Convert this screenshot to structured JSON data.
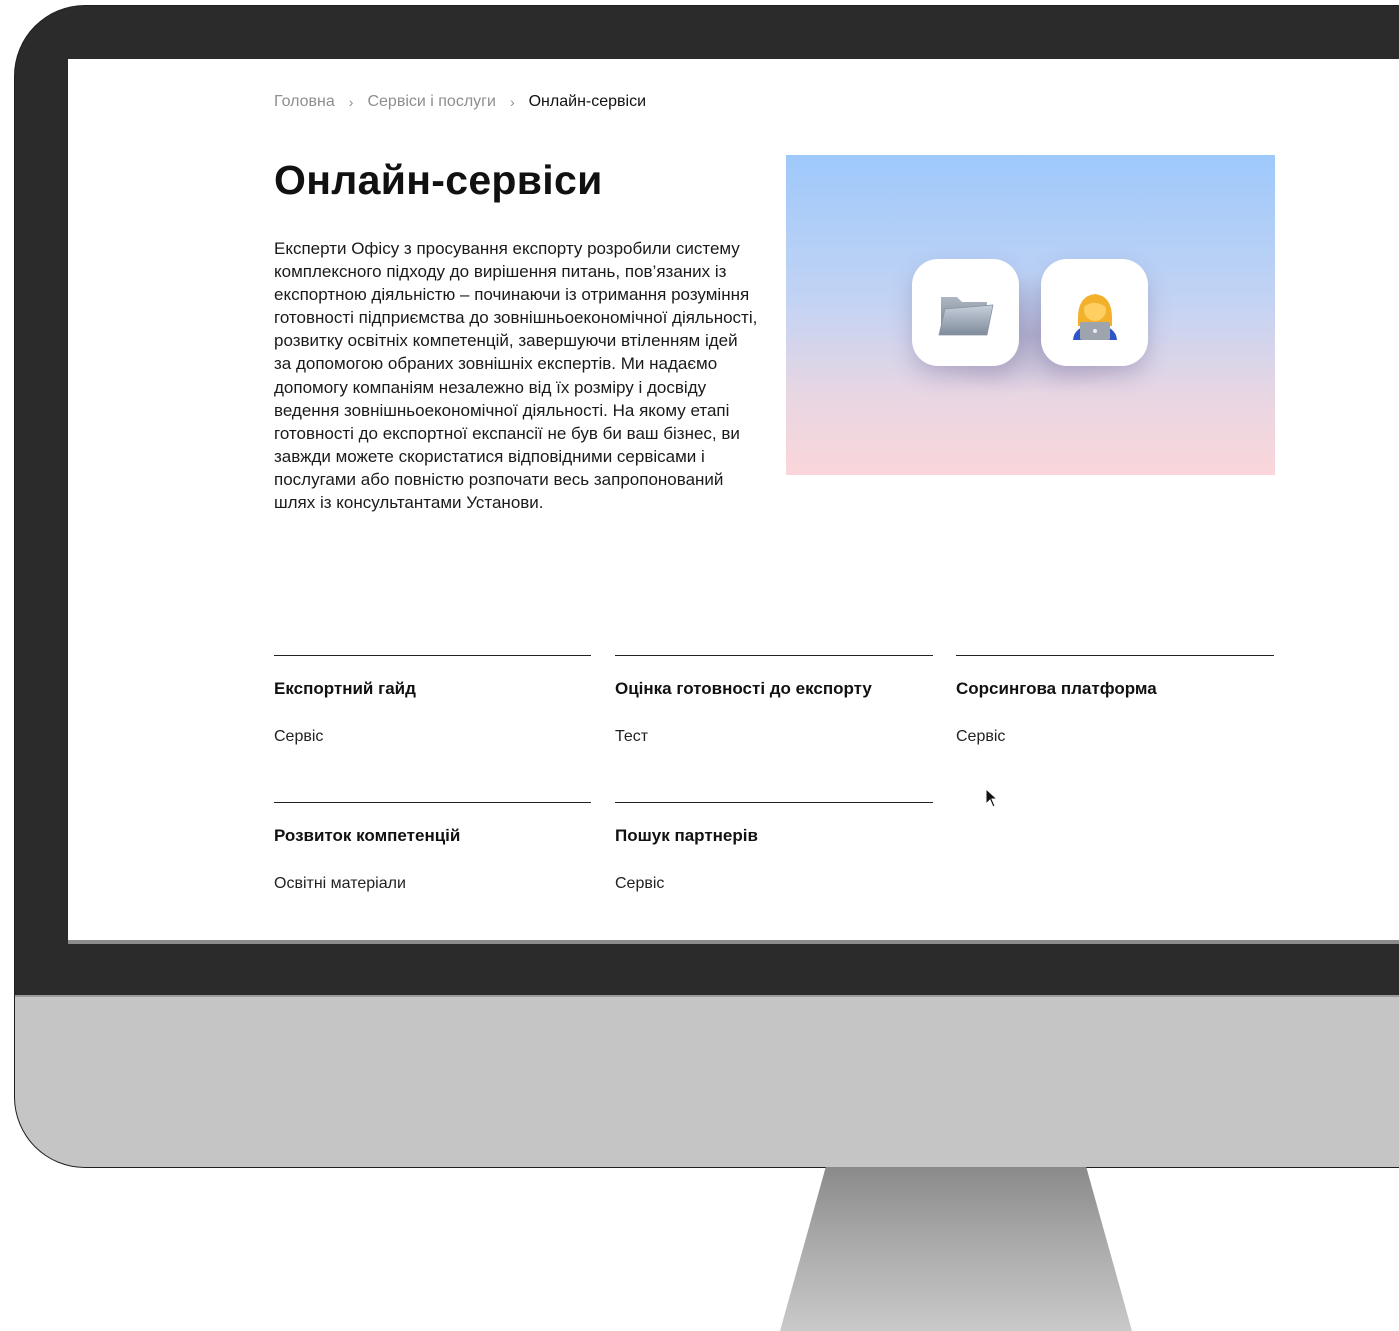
{
  "breadcrumb": {
    "items": [
      "Головна",
      "Сервіси і послуги",
      "Онлайн-сервіси"
    ],
    "separator": "›"
  },
  "page": {
    "title": "Онлайн-сервіси",
    "intro": "Експерти Офісу з просування експорту розробили систему комплексного підходу до вирішення питань, пов’язаних із експортною діяльністю – починаючи із отримання розуміння готовності підприємства до зовнішньоекономічної діяльності, розвитку освітніх компетенцій, завершуючи втіленням ідей за допомогою обраних зовнішніх експертів. Ми надаємо допомогу компаніям незалежно від їх розміру і досвіду ведення зовнішньоекономічної діяльності. На якому етапі готовності до експортної експансії не був би ваш бізнес, ви завжди можете скористатися відповідними сервісами і послугами або повністю розпочати весь запропонований шлях із консультантами Установи."
  },
  "hero": {
    "icons": [
      "folder-icon",
      "woman-technologist-icon"
    ],
    "gradient_top": "#9ec9fb",
    "gradient_bottom": "#fad6da"
  },
  "services": [
    {
      "name": "Експортний гайд",
      "type": "Сервіс"
    },
    {
      "name": "Оцінка готовності до експорту",
      "type": "Тест"
    },
    {
      "name": "Сорсингова платформа",
      "type": "Сервіс"
    },
    {
      "name": "Розвиток компетенцій",
      "type": "Освітні матеріали"
    },
    {
      "name": "Пошук партнерів",
      "type": "Сервіс"
    }
  ],
  "colors": {
    "text": "#111111",
    "muted": "#8e8e8e",
    "bezel": "#2b2b2b",
    "chin": "#c4c5c4"
  }
}
